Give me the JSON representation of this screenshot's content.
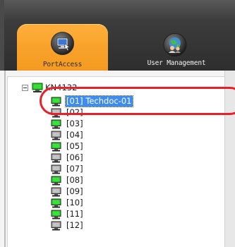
{
  "tabs": [
    {
      "label": "PortAccess",
      "active": true,
      "icon": "port-access-icon"
    },
    {
      "label": "User Management",
      "active": false,
      "icon": "user-management-icon"
    }
  ],
  "tree": {
    "root": {
      "label": "KN4132",
      "expanded": true,
      "icon": "kvm-switch-icon"
    },
    "items": [
      {
        "label": "[01] Techdoc-01",
        "status": "online",
        "selected": true
      },
      {
        "label": "[02]",
        "status": "offline",
        "selected": false
      },
      {
        "label": "[03]",
        "status": "online",
        "selected": false
      },
      {
        "label": "[04]",
        "status": "offline",
        "selected": false
      },
      {
        "label": "[05]",
        "status": "online",
        "selected": false
      },
      {
        "label": "[06]",
        "status": "offline",
        "selected": false
      },
      {
        "label": "[07]",
        "status": "offline",
        "selected": false
      },
      {
        "label": "[08]",
        "status": "online",
        "selected": false
      },
      {
        "label": "[09]",
        "status": "offline",
        "selected": false
      },
      {
        "label": "[10]",
        "status": "online",
        "selected": false
      },
      {
        "label": "[11]",
        "status": "online",
        "selected": false
      },
      {
        "label": "[12]",
        "status": "offline",
        "selected": false
      }
    ]
  },
  "colors": {
    "active_tab": "#f8a12a",
    "header": "#3c3c3c",
    "selection": "#3f8cf0",
    "annotation": "#e8202c",
    "online": "#22c322",
    "offline": "#9a9a9a"
  }
}
